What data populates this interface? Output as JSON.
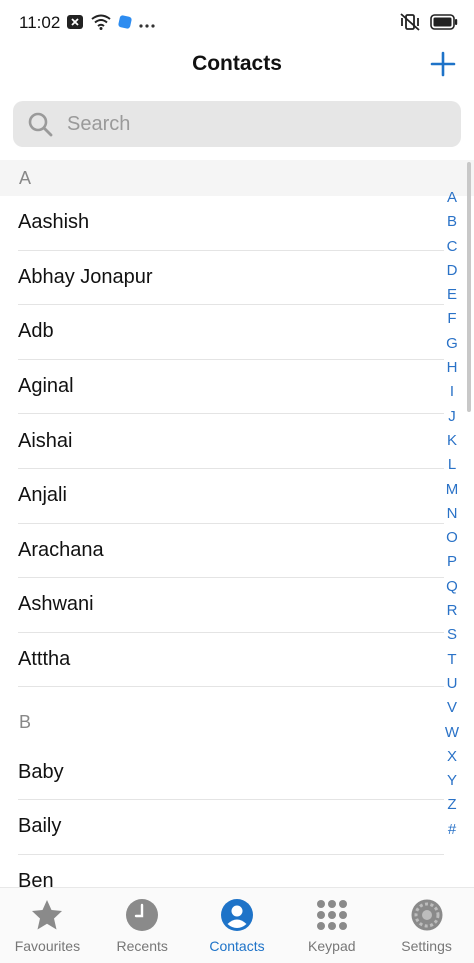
{
  "status_bar": {
    "time": "11:02",
    "left_icons": [
      "notification-x-icon",
      "wifi-icon",
      "app-icon",
      "more-dots-icon"
    ],
    "right_icons": [
      "vibrate-icon",
      "battery-icon"
    ]
  },
  "header": {
    "title": "Contacts",
    "add_icon": "plus-icon"
  },
  "search": {
    "placeholder": "Search"
  },
  "sections": [
    {
      "letter": "A",
      "contacts": [
        "Aashish",
        "Abhay Jonapur",
        "Adb",
        "Aginal",
        "Aishai",
        "Anjali",
        "Arachana",
        "Ashwani",
        "Atttha"
      ]
    },
    {
      "letter": "B",
      "contacts": [
        "Baby",
        "Baily",
        "Ben"
      ]
    }
  ],
  "alphabet_index": [
    "A",
    "B",
    "C",
    "D",
    "E",
    "F",
    "G",
    "H",
    "I",
    "J",
    "K",
    "L",
    "M",
    "N",
    "O",
    "P",
    "Q",
    "R",
    "S",
    "T",
    "U",
    "V",
    "W",
    "X",
    "Y",
    "Z",
    "#"
  ],
  "bottom_nav": {
    "items": [
      {
        "label": "Favourites",
        "icon": "star-icon"
      },
      {
        "label": "Recents",
        "icon": "clock-icon"
      },
      {
        "label": "Contacts",
        "icon": "person-icon",
        "active": true
      },
      {
        "label": "Keypad",
        "icon": "keypad-icon"
      },
      {
        "label": "Settings",
        "icon": "gear-icon"
      }
    ]
  },
  "colors": {
    "accent": "#1e73c8",
    "index_letters": "#2a72c7",
    "inactive_icon": "#8a8a8a"
  }
}
